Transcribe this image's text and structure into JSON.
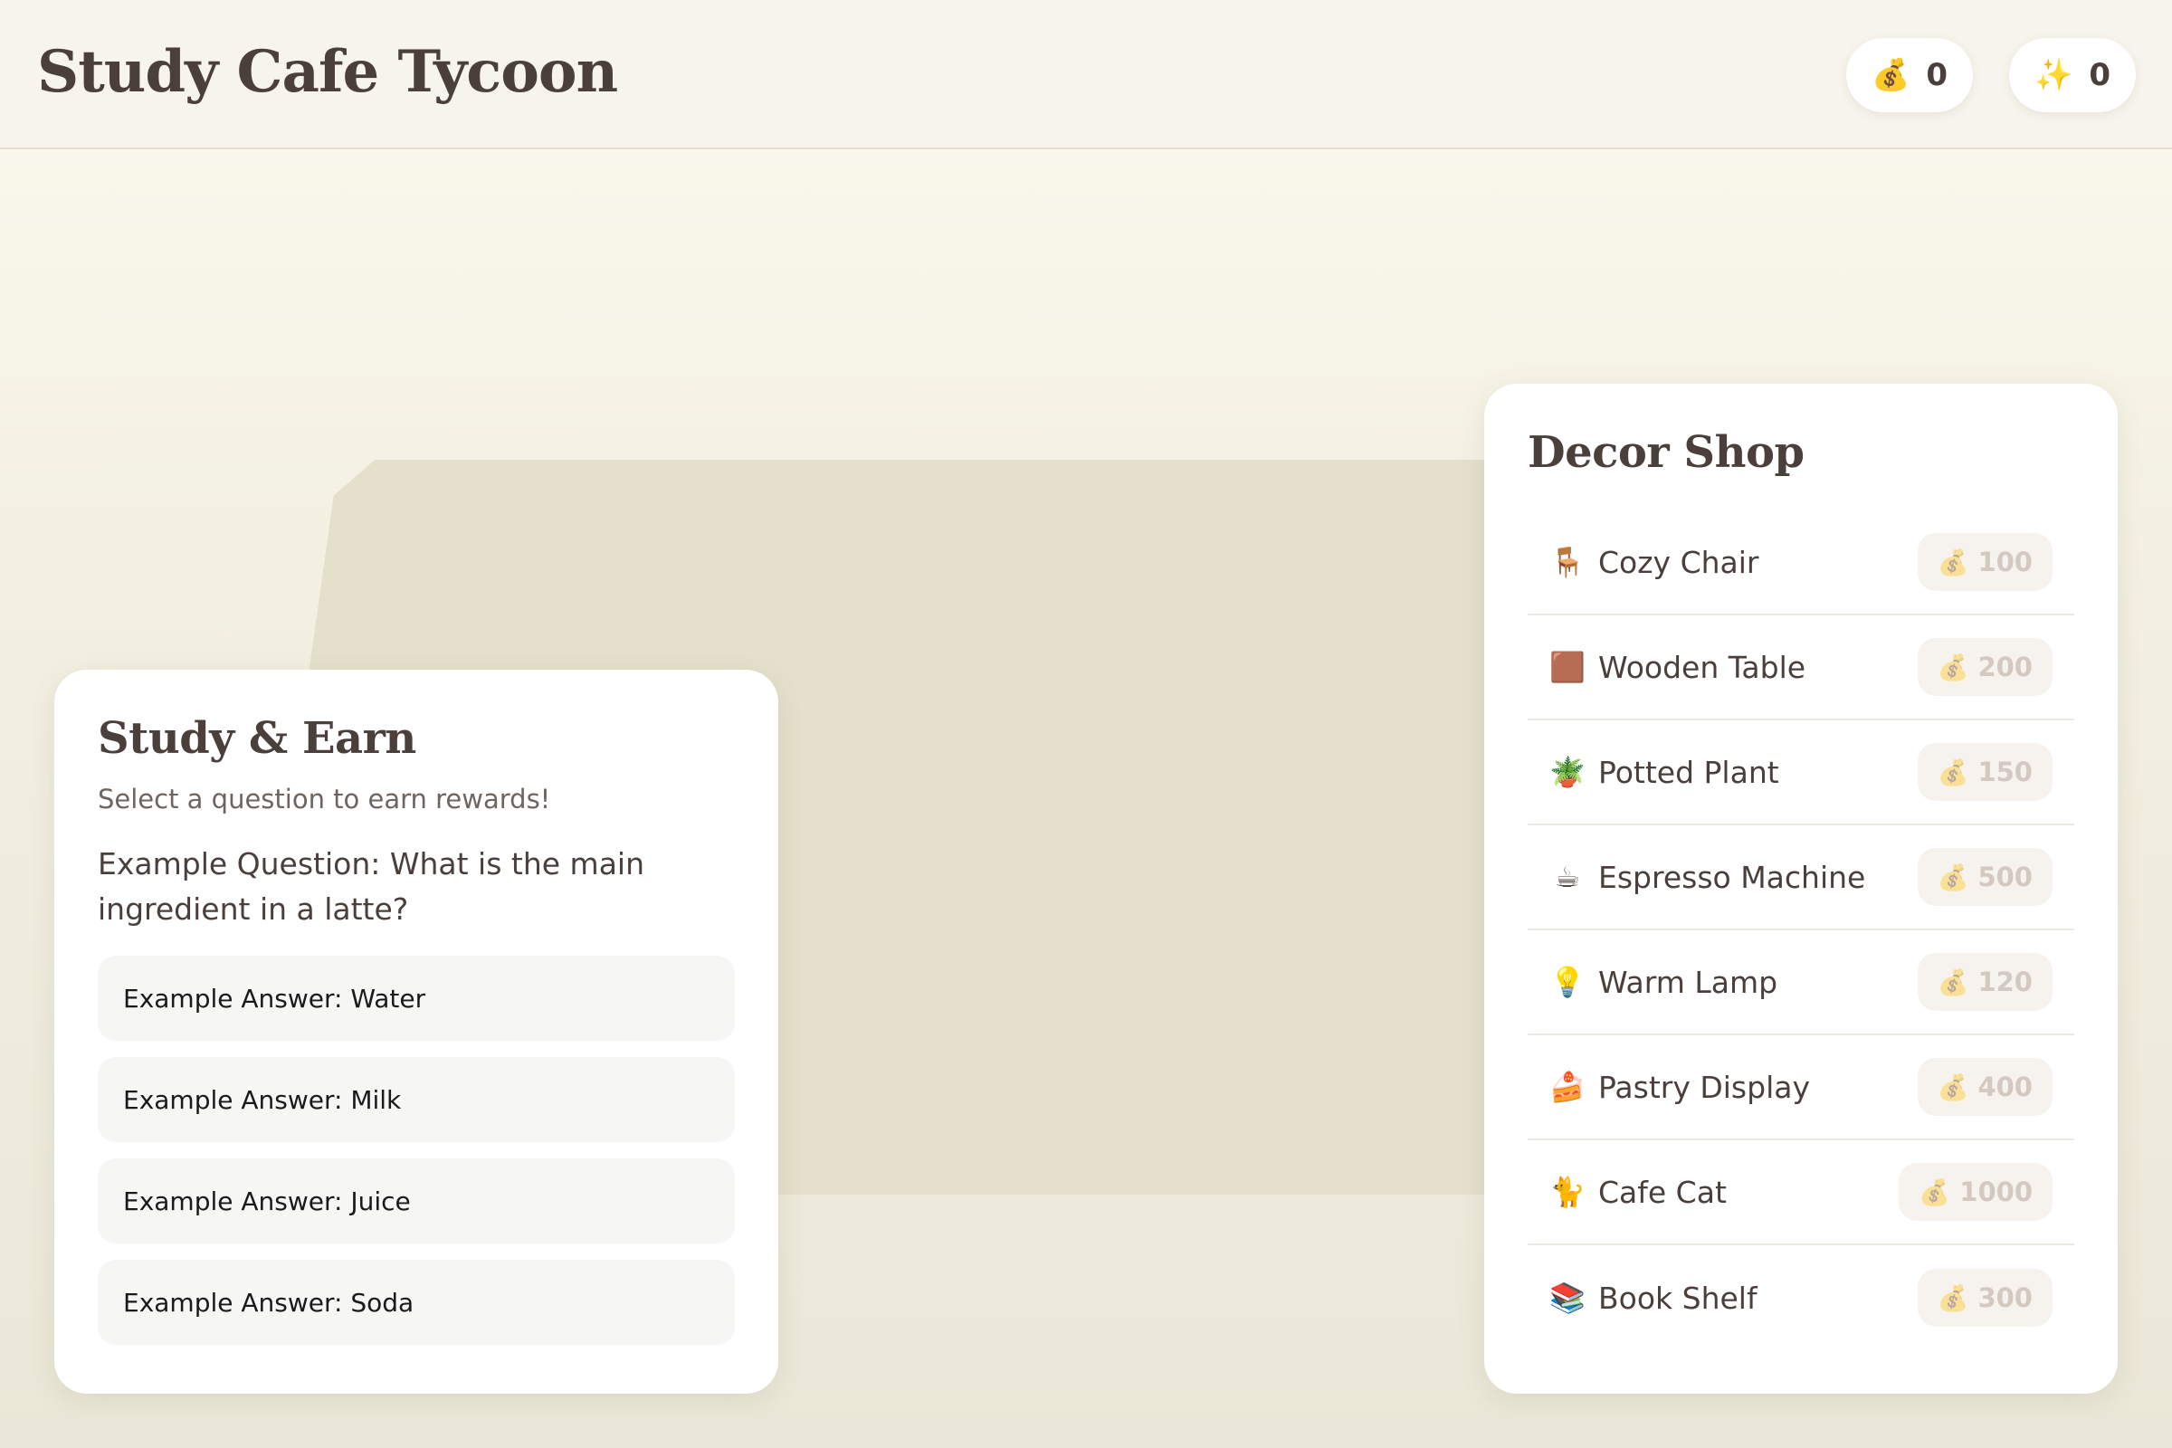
{
  "header": {
    "title": "Study Cafe Tycoon",
    "coins": {
      "icon": "money-bag-icon",
      "glyph": "💰",
      "value": "0"
    },
    "stars": {
      "icon": "sparkles-icon",
      "glyph": "✨",
      "value": "0"
    }
  },
  "study": {
    "title": "Study & Earn",
    "subtitle": "Select a question to earn rewards!",
    "question": "Example Question: What is the main ingredient in a latte?",
    "answers": [
      "Example Answer: Water",
      "Example Answer: Milk",
      "Example Answer: Juice",
      "Example Answer: Soda"
    ]
  },
  "shop": {
    "title": "Decor Shop",
    "price_glyph": "💰",
    "items": [
      {
        "name": "Cozy Chair",
        "icon": "chair-icon",
        "glyph": "🪑",
        "price": "100"
      },
      {
        "name": "Wooden Table",
        "icon": "brown-square-icon",
        "glyph": "🟫",
        "price": "200"
      },
      {
        "name": "Potted Plant",
        "icon": "potted-plant-icon",
        "glyph": "🪴",
        "price": "150"
      },
      {
        "name": "Espresso Machine",
        "icon": "coffee-icon",
        "glyph": "☕",
        "price": "500"
      },
      {
        "name": "Warm Lamp",
        "icon": "light-bulb-icon",
        "glyph": "💡",
        "price": "120"
      },
      {
        "name": "Pastry Display",
        "icon": "cake-icon",
        "glyph": "🍰",
        "price": "400"
      },
      {
        "name": "Cafe Cat",
        "icon": "cat-icon",
        "glyph": "🐈",
        "price": "1000"
      },
      {
        "name": "Book Shelf",
        "icon": "books-icon",
        "glyph": "📚",
        "price": "300"
      }
    ]
  },
  "colors": {
    "background": "#f3f0e2",
    "floor": "#e4e0cc",
    "text": "#4a3f3a",
    "price_disabled": "#d4c9c0"
  }
}
